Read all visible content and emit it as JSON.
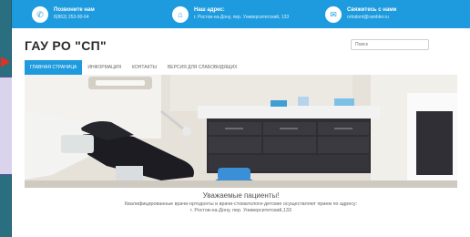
{
  "top_bar": {
    "contacts": [
      {
        "icon": "phone-icon",
        "title": "Позвоните нам",
        "detail": "8(863) 253-90-64"
      },
      {
        "icon": "location-icon",
        "title": "Наш адрес:",
        "detail": "г. Ростов-на-Дону, пер. Университетский, 133"
      },
      {
        "icon": "mail-icon",
        "title": "Свяжитесь с нами",
        "detail": "ortodont@rambler.ru"
      }
    ]
  },
  "header": {
    "logo": "ГАУ РО \"СП\"",
    "search_placeholder": "Поиск"
  },
  "nav": {
    "items": [
      {
        "label": "Главная страница",
        "active": true
      },
      {
        "label": "Информация",
        "active": false
      },
      {
        "label": "Контакты",
        "active": false
      },
      {
        "label": "Версия для слабовидящих",
        "active": false
      }
    ]
  },
  "content": {
    "greeting": "Уважаемые пациенты!",
    "message_line1": "Квалифицированные врачи-ортодонты и врачи-стоматологи-детские осуществляют прием по адресу:",
    "message_line2": "г. Ростов-на-Дону, пер. Университетский,133"
  },
  "colors": {
    "accent": "#1e9bde",
    "frame": "#1f5a6b"
  }
}
